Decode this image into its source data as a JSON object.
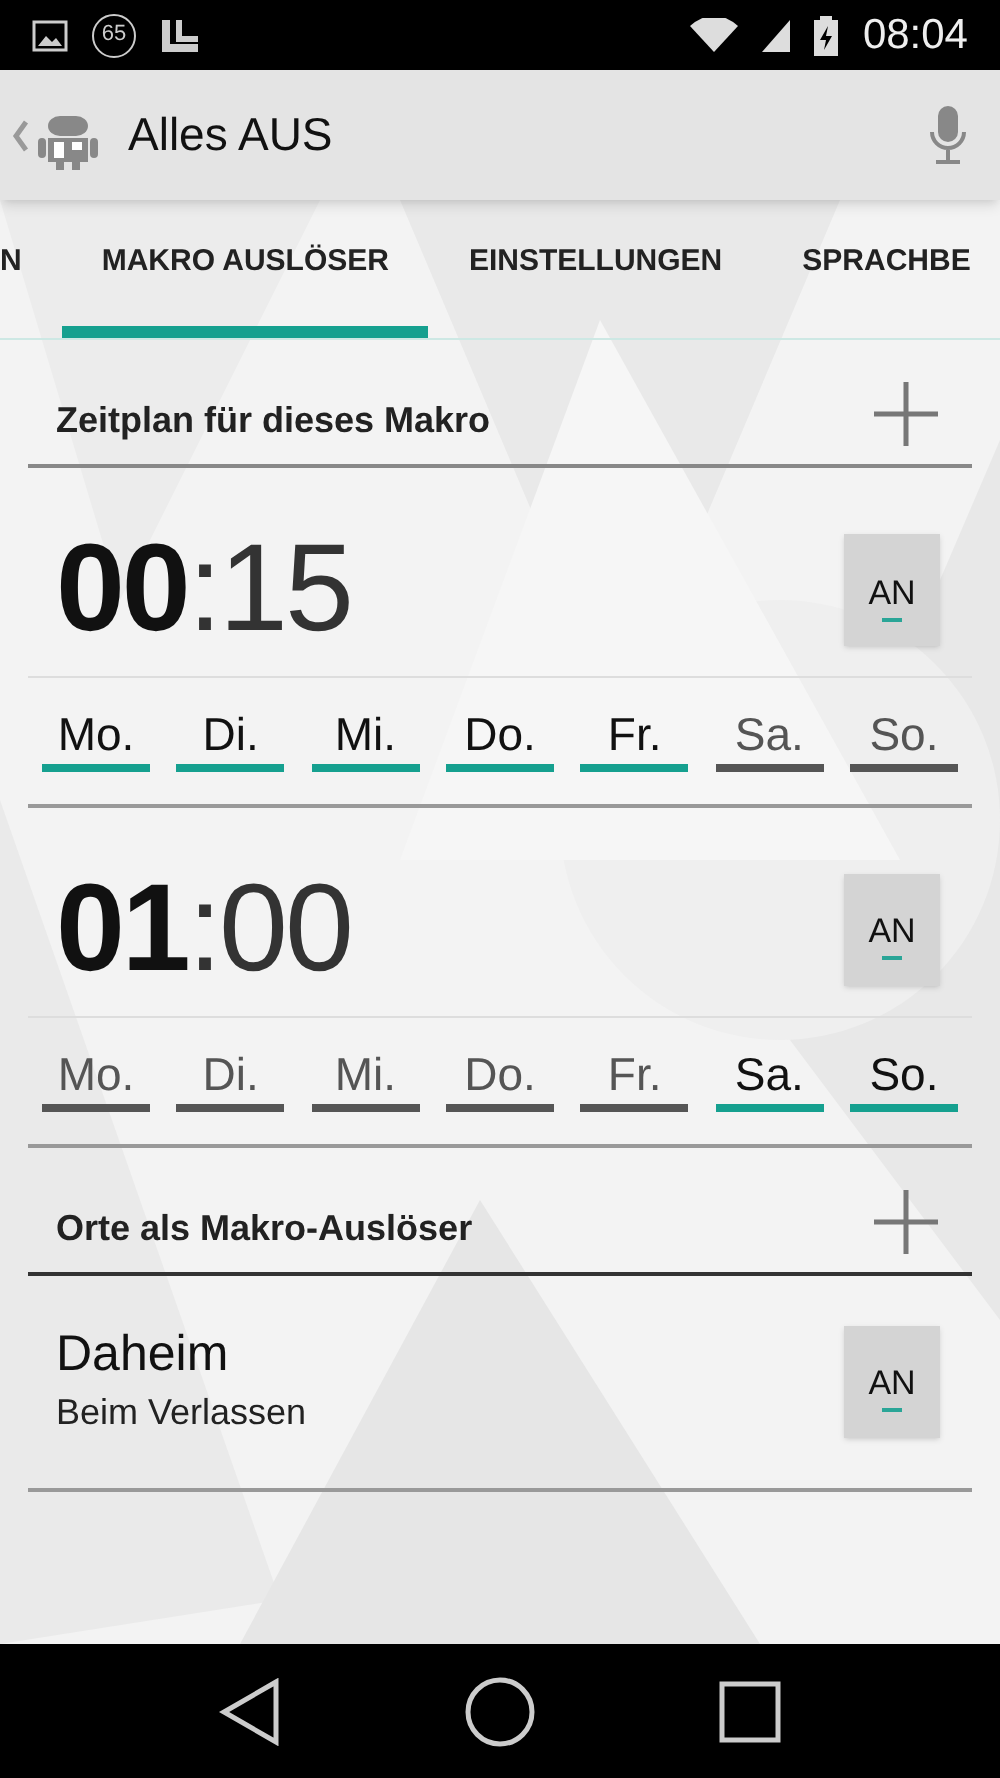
{
  "status_bar": {
    "notification_count": "65",
    "time": "08:04"
  },
  "action_bar": {
    "title": "Alles AUS"
  },
  "tabs": [
    {
      "label": "N",
      "selected": false
    },
    {
      "label": "MAKRO AUSLÖSER",
      "selected": true
    },
    {
      "label": "EINSTELLUNGEN",
      "selected": false
    },
    {
      "label": "SPRACHBE",
      "selected": false
    }
  ],
  "schedule": {
    "title": "Zeitplan für dieses Makro",
    "entries": [
      {
        "hours": "00",
        "minutes": ":15",
        "toggle": {
          "label": "AN",
          "on": true
        },
        "days": [
          {
            "label": "Mo.",
            "selected": true
          },
          {
            "label": "Di.",
            "selected": true
          },
          {
            "label": "Mi.",
            "selected": true
          },
          {
            "label": "Do.",
            "selected": true
          },
          {
            "label": "Fr.",
            "selected": true
          },
          {
            "label": "Sa.",
            "selected": false
          },
          {
            "label": "So.",
            "selected": false
          }
        ]
      },
      {
        "hours": "01",
        "minutes": ":00",
        "toggle": {
          "label": "AN",
          "on": true
        },
        "days": [
          {
            "label": "Mo.",
            "selected": false
          },
          {
            "label": "Di.",
            "selected": false
          },
          {
            "label": "Mi.",
            "selected": false
          },
          {
            "label": "Do.",
            "selected": false
          },
          {
            "label": "Fr.",
            "selected": false
          },
          {
            "label": "Sa.",
            "selected": true
          },
          {
            "label": "So.",
            "selected": true
          }
        ]
      }
    ]
  },
  "locations": {
    "title": "Orte als Makro-Auslöser",
    "entries": [
      {
        "name": "Daheim",
        "trigger": "Beim Verlassen",
        "toggle": {
          "label": "AN",
          "on": true
        }
      }
    ]
  }
}
